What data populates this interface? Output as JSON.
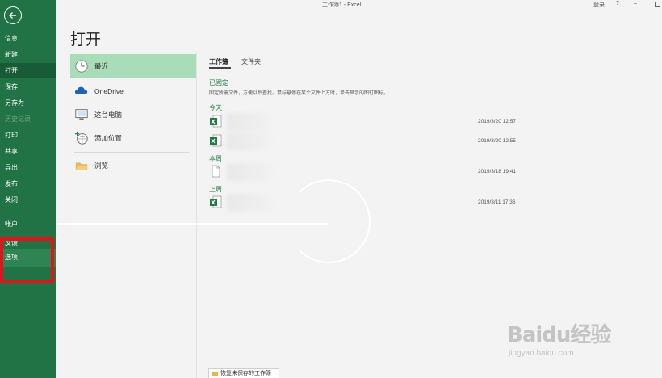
{
  "window": {
    "title": "工作簿1 - Excel",
    "login": "登录",
    "help": "?",
    "minimize": "–"
  },
  "nav": {
    "items": [
      {
        "label": "信息",
        "state": "normal"
      },
      {
        "label": "新建",
        "state": "normal"
      },
      {
        "label": "打开",
        "state": "active"
      },
      {
        "label": "保存",
        "state": "normal"
      },
      {
        "label": "另存为",
        "state": "normal"
      },
      {
        "label": "历史记录",
        "state": "disabled"
      },
      {
        "label": "打印",
        "state": "normal"
      },
      {
        "label": "共享",
        "state": "normal"
      },
      {
        "label": "导出",
        "state": "normal"
      },
      {
        "label": "发布",
        "state": "normal"
      },
      {
        "label": "关闭",
        "state": "normal"
      },
      {
        "label": "帐户",
        "state": "normal"
      },
      {
        "label": "反馈",
        "state": "normal"
      },
      {
        "label": "选项",
        "state": "hover"
      }
    ]
  },
  "page": {
    "title": "打开"
  },
  "locations": [
    {
      "label": "最近",
      "icon": "clock-icon",
      "active": true
    },
    {
      "label": "OneDrive",
      "icon": "cloud-icon",
      "active": false
    },
    {
      "label": "这台电脑",
      "icon": "computer-icon",
      "active": false
    },
    {
      "label": "添加位置",
      "icon": "globe-plus-icon",
      "active": false
    },
    {
      "label": "浏览",
      "icon": "folder-icon",
      "active": false
    }
  ],
  "tabs": [
    {
      "label": "工作簿",
      "active": true
    },
    {
      "label": "文件夹",
      "active": false
    }
  ],
  "pinned": {
    "heading": "已固定",
    "hint": "固定所需文件，方便以后查找。鼠标悬停在某个文件上方时，单击显示的图钉图标。"
  },
  "groups": {
    "today": "今天",
    "this_week": "本周",
    "last_week": "上周"
  },
  "files": [
    {
      "date": "2019/3/20 12:57",
      "icon": "excel-file-icon"
    },
    {
      "date": "2019/3/20 12:55",
      "icon": "excel-file-icon"
    },
    {
      "date": "2019/3/18 19:41",
      "icon": "blank-file-icon"
    },
    {
      "date": "2019/3/11 17:36",
      "icon": "excel-file-icon"
    }
  ],
  "recover_button": "恢复未保存的工作簿",
  "watermark": {
    "brand": "Baidu经验",
    "url": "jingyan.baidu.com"
  },
  "colors": {
    "nav_bg": "#217346",
    "nav_active": "#185c37",
    "recent_active": "#a9dcb8",
    "highlight": "#e0141a",
    "green_text": "#1f7a43"
  }
}
